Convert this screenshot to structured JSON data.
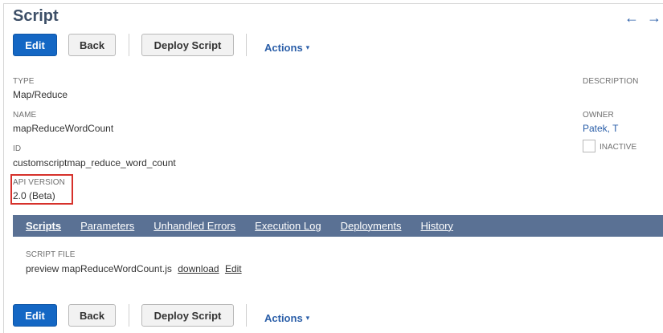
{
  "page": {
    "title": "Script"
  },
  "nav": {
    "back_arrow": "←",
    "forward_arrow": "→"
  },
  "toolbar": {
    "edit_label": "Edit",
    "back_label": "Back",
    "deploy_label": "Deploy Script",
    "actions_label": "Actions",
    "actions_caret": "▾"
  },
  "fields": {
    "type_label": "TYPE",
    "type_value": "Map/Reduce",
    "name_label": "NAME",
    "name_value": "mapReduceWordCount",
    "id_label": "ID",
    "id_value": "customscriptmap_reduce_word_count",
    "api_version_label": "API VERSION",
    "api_version_value": "2.0 (Beta)",
    "description_label": "DESCRIPTION",
    "owner_label": "OWNER",
    "owner_value": "Patek, T",
    "inactive_label": "INACTIVE"
  },
  "tabs": [
    {
      "label": "Scripts",
      "active": true
    },
    {
      "label": "Parameters",
      "active": false
    },
    {
      "label": "Unhandled Errors",
      "active": false
    },
    {
      "label": "Execution Log",
      "active": false
    },
    {
      "label": "Deployments",
      "active": false
    },
    {
      "label": "History",
      "active": false
    }
  ],
  "script_file": {
    "label": "SCRIPT FILE",
    "preview_text": "preview mapReduceWordCount.js",
    "download_label": "download",
    "edit_label": "Edit"
  },
  "colors": {
    "primary_button": "#1467c4",
    "tab_bar": "#5a7194",
    "link": "#2a5ea8",
    "highlight": "#d6312b",
    "title": "#3d4f67"
  }
}
